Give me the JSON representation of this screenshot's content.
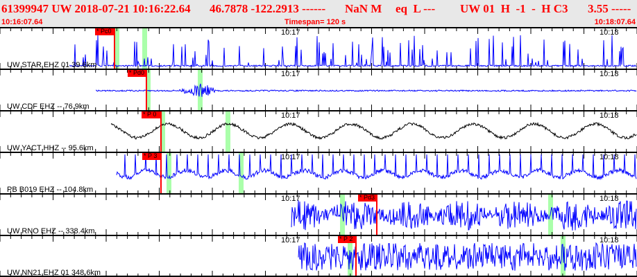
{
  "header": {
    "event": "61399947 UW 2018-07-21 10:16:22.64",
    "location": "46.7878 -122.2913 ------",
    "magnitude": "NaN M",
    "type": "eq  L ---",
    "source": "UW 01  H  -1  -  H C3",
    "value": "3.55 -----",
    "start_time": "10:16:07.64",
    "timespan": "Timespan= 120 s",
    "end_time": "10:18:07.64"
  },
  "colors": {
    "trace": "#0000ff",
    "pick": "#ff0000",
    "window": "#aaffaa",
    "header_bg": "#e8e8e8"
  },
  "time_marks": [
    "10:17",
    "10:18"
  ],
  "panels": [
    {
      "label": "UW STAR EHZ 01 39.6km",
      "pick": "* Pc0",
      "trace_color": "#0000ff"
    },
    {
      "label": "UW CDF EHZ -- 76.9km",
      "pick": "* Pd0",
      "trace_color": "#0000ff"
    },
    {
      "label": "UW YACT HHZ -- 95.6km",
      "pick": "* P 0",
      "trace_color": "#000000"
    },
    {
      "label": "PB B019 EHZ -- 104.8km",
      "pick": "* P 3",
      "trace_color": "#0000ff"
    },
    {
      "label": "UW RNO EHZ -- 338.4km",
      "pick": "* Pd3",
      "trace_color": "#0000ff"
    },
    {
      "label": "UW NN21 EHZ 01 348.6km",
      "pick": "* P 2",
      "trace_color": "#0000ff"
    }
  ]
}
